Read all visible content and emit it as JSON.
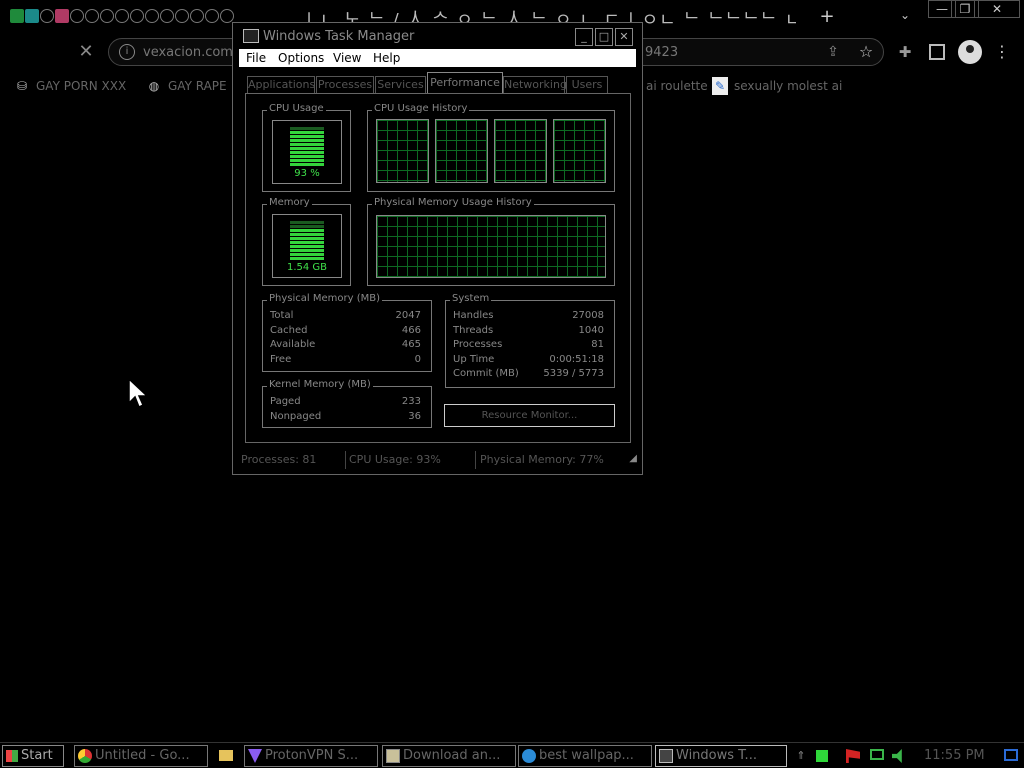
{
  "browser": {
    "tab_title_text": "| ㄴ 노 ᄂ / 人 ᄉ ㅇ ᄂ 人 ᄂ ㅇ ㄴ ㄷ | ㅇㄴ ᄂ ᄂᄂᄂᄂ ㄴ ㄴ",
    "url_visible": "vexacion.com",
    "url_tail": "9423",
    "new_tab_glyph": "+",
    "tab_search_glyph": "⌄",
    "minimize_glyph": "—",
    "restore_glyph": "❐",
    "close_glyph": "✕",
    "stop_glyph": "✕",
    "info_glyph": "i",
    "share_glyph": "⇪",
    "star_glyph": "☆",
    "extensions_glyph": "✚",
    "menu_glyph": "⋮",
    "tab_icon_texts": [
      "¥",
      "₴",
      "$",
      "SIR PE"
    ],
    "bookmarks": [
      {
        "label": "GAY PORN XXX",
        "icon": "⛁"
      },
      {
        "label": "GAY RAPE",
        "icon": "◍"
      },
      {
        "label": "ai roulette",
        "icon": ""
      },
      {
        "label": "sexually molest ai",
        "icon": "✎"
      }
    ]
  },
  "task_manager": {
    "title": "Windows Task Manager",
    "controls": {
      "minimize": "_",
      "maximize": "□",
      "close": "✕"
    },
    "menus": [
      "File",
      "Options",
      "View",
      "Help"
    ],
    "tabs": [
      "Applications",
      "Processes",
      "Services",
      "Performance",
      "Networking",
      "Users"
    ],
    "active_tab": "Performance",
    "cpu_usage": {
      "label": "CPU Usage",
      "value": "93 %",
      "level": 0.93
    },
    "cpu_history_label": "CPU Usage History",
    "memory": {
      "label": "Memory",
      "value": "1.54 GB",
      "level": 0.77
    },
    "memory_history_label": "Physical Memory Usage History",
    "physical_memory": {
      "label": "Physical Memory (MB)",
      "rows": [
        {
          "label": "Total",
          "value": "2047"
        },
        {
          "label": "Cached",
          "value": "466"
        },
        {
          "label": "Available",
          "value": "465"
        },
        {
          "label": "Free",
          "value": "0"
        }
      ]
    },
    "kernel_memory": {
      "label": "Kernel Memory (MB)",
      "rows": [
        {
          "label": "Paged",
          "value": "233"
        },
        {
          "label": "Nonpaged",
          "value": "36"
        }
      ]
    },
    "system": {
      "label": "System",
      "rows": [
        {
          "label": "Handles",
          "value": "27008"
        },
        {
          "label": "Threads",
          "value": "1040"
        },
        {
          "label": "Processes",
          "value": "81"
        },
        {
          "label": "Up Time",
          "value": "0:00:51:18"
        },
        {
          "label": "Commit (MB)",
          "value": "5339 / 5773"
        }
      ]
    },
    "resource_monitor_button": "Resource Monitor...",
    "status": {
      "processes": "Processes: 81",
      "cpu": "CPU Usage: 93%",
      "memory": "Physical Memory: 77%"
    },
    "grip_glyph": "◢"
  },
  "taskbar": {
    "start_label": "Start",
    "items": [
      {
        "label": "Untitled - Go...",
        "active": false
      },
      {
        "label": "",
        "active": false
      },
      {
        "label": "ProtonVPN S...",
        "active": false
      },
      {
        "label": "Download an...",
        "active": false
      },
      {
        "label": "best wallpap...",
        "active": false
      },
      {
        "label": "Windows T...",
        "active": true
      }
    ],
    "clock": "11:55 PM",
    "tray_up_glyph": "⇑",
    "colors": {
      "green": "#2fd83a",
      "red": "#d42323"
    }
  }
}
